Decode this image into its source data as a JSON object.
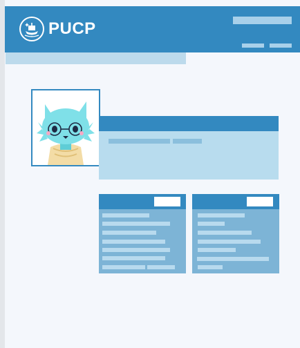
{
  "header": {
    "logo_text": "PUCP",
    "logo_icon": "ship-icon"
  },
  "colors": {
    "brand": "#3389c0",
    "panel": "#b8dcee",
    "card": "#7db4d6",
    "background": "#f4f7fc"
  }
}
